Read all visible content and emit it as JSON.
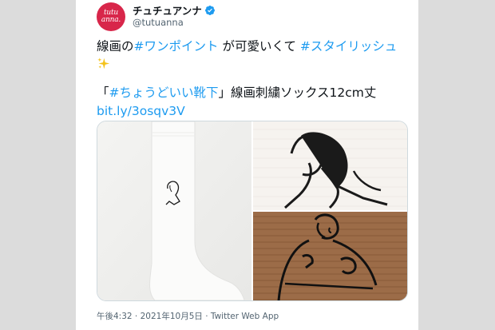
{
  "user": {
    "display_name": "チュチュアンナ",
    "handle": "@tutuanna",
    "avatar_text": "tutu\nanna."
  },
  "tweet": {
    "line1": {
      "t1": "線画の",
      "h1": "#ワンポイント",
      "t2": " が可愛いくて ",
      "h2": "#スタイリッシュ"
    },
    "line2_emoji": "sparkles",
    "line3": {
      "open": "「",
      "h3": "#ちょうどいい靴下",
      "rest": "」線画刺繍ソックス12cm丈"
    },
    "link": "bit.ly/3osqv3V"
  },
  "meta": {
    "time": "午後4:32",
    "sep1": " · ",
    "date": "2021年10月5日",
    "sep2": " · ",
    "source": "Twitter Web App"
  },
  "colors": {
    "link": "#1d9bf0",
    "avatar_bg": "#d8264a",
    "secondary_text": "#536471"
  }
}
